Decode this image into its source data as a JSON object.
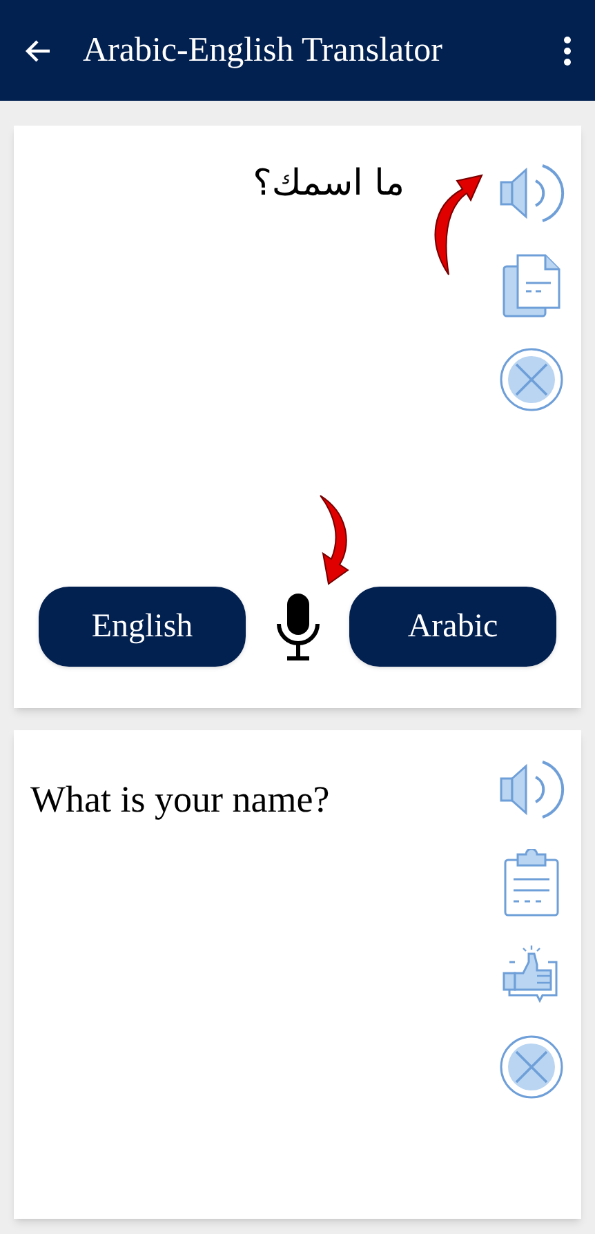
{
  "app_bar": {
    "title": "Arabic-English Translator"
  },
  "source": {
    "text": "ما اسمك؟"
  },
  "languages": [
    {
      "label": "English"
    },
    {
      "label": "Arabic"
    }
  ],
  "output": {
    "text": "What is your name?"
  }
}
